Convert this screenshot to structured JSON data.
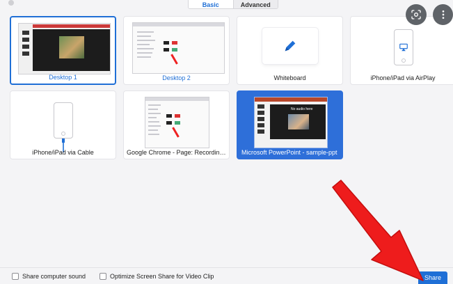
{
  "tabs": {
    "basic": "Basic",
    "advanced": "Advanced"
  },
  "tiles": [
    {
      "label": "Desktop 1"
    },
    {
      "label": "Desktop 2"
    },
    {
      "label": "Whiteboard"
    },
    {
      "label": "iPhone/iPad via AirPlay"
    },
    {
      "label": "iPhone/iPad via Cable"
    },
    {
      "label": "Google Chrome - Page: Recording..."
    },
    {
      "label": "Microsoft PowerPoint - sample-ppt"
    }
  ],
  "footer": {
    "share_sound": "Share computer sound",
    "optimize_video": "Optimize Screen Share for Video Clip",
    "share_button": "Share"
  },
  "ppt_slide_text": "No audio here",
  "colors": {
    "accent": "#1f6fd6",
    "arrow": "#ee1c1c"
  }
}
